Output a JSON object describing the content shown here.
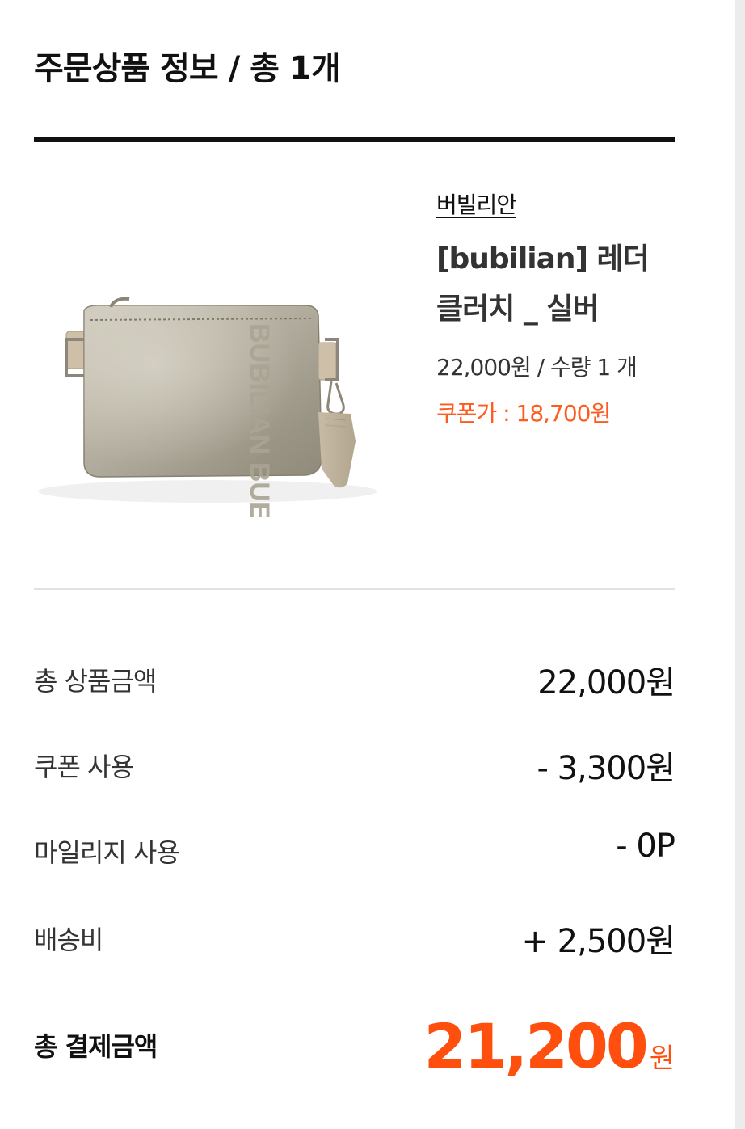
{
  "order": {
    "title": "주문상품 정보 / 총 1개"
  },
  "product": {
    "brand": "버빌리안",
    "name": "[bubilian] 레더 클러치 _ 실버",
    "price_qty": "22,000원 / 수량 1 개",
    "coupon_price": "쿠폰가 : 18,700원",
    "image_icon": "silver-leather-clutch-image"
  },
  "summary": {
    "rows": [
      {
        "label": "총 상품금액",
        "value": "22,000원"
      },
      {
        "label": "쿠폰 사용",
        "value": "- 3,300원"
      },
      {
        "label": "마일리지 사용",
        "value": "- 0P"
      },
      {
        "label": "배송비",
        "value": "+ 2,500원"
      }
    ],
    "total_label": "총 결제금액",
    "total_value": "21,200",
    "total_unit": "원"
  },
  "colors": {
    "accent": "#ff5a1f",
    "text": "#111111",
    "divider": "#e2e2e2"
  }
}
